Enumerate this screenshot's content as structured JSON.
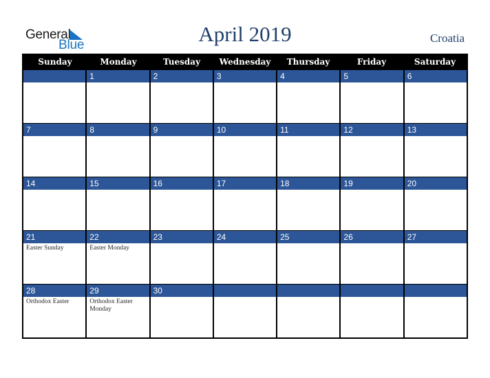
{
  "logo": {
    "line1": "General",
    "line2": "Blue",
    "icon": "blue-triangle-icon"
  },
  "header": {
    "title": "April 2019",
    "country": "Croatia"
  },
  "colors": {
    "header_bg": "#000000",
    "day_bar": "#2c5697",
    "title": "#213f6b",
    "logo_blue": "#1a73c0"
  },
  "weekdays": [
    "Sunday",
    "Monday",
    "Tuesday",
    "Wednesday",
    "Thursday",
    "Friday",
    "Saturday"
  ],
  "weeks": [
    [
      {
        "day": "",
        "holiday": ""
      },
      {
        "day": "1",
        "holiday": ""
      },
      {
        "day": "2",
        "holiday": ""
      },
      {
        "day": "3",
        "holiday": ""
      },
      {
        "day": "4",
        "holiday": ""
      },
      {
        "day": "5",
        "holiday": ""
      },
      {
        "day": "6",
        "holiday": ""
      }
    ],
    [
      {
        "day": "7",
        "holiday": ""
      },
      {
        "day": "8",
        "holiday": ""
      },
      {
        "day": "9",
        "holiday": ""
      },
      {
        "day": "10",
        "holiday": ""
      },
      {
        "day": "11",
        "holiday": ""
      },
      {
        "day": "12",
        "holiday": ""
      },
      {
        "day": "13",
        "holiday": ""
      }
    ],
    [
      {
        "day": "14",
        "holiday": ""
      },
      {
        "day": "15",
        "holiday": ""
      },
      {
        "day": "16",
        "holiday": ""
      },
      {
        "day": "17",
        "holiday": ""
      },
      {
        "day": "18",
        "holiday": ""
      },
      {
        "day": "19",
        "holiday": ""
      },
      {
        "day": "20",
        "holiday": ""
      }
    ],
    [
      {
        "day": "21",
        "holiday": "Easter Sunday"
      },
      {
        "day": "22",
        "holiday": "Easter Monday"
      },
      {
        "day": "23",
        "holiday": ""
      },
      {
        "day": "24",
        "holiday": ""
      },
      {
        "day": "25",
        "holiday": ""
      },
      {
        "day": "26",
        "holiday": ""
      },
      {
        "day": "27",
        "holiday": ""
      }
    ],
    [
      {
        "day": "28",
        "holiday": "Orthodox Easter"
      },
      {
        "day": "29",
        "holiday": "Orthodox Easter Monday"
      },
      {
        "day": "30",
        "holiday": ""
      },
      {
        "day": "",
        "holiday": ""
      },
      {
        "day": "",
        "holiday": ""
      },
      {
        "day": "",
        "holiday": ""
      },
      {
        "day": "",
        "holiday": ""
      }
    ]
  ]
}
